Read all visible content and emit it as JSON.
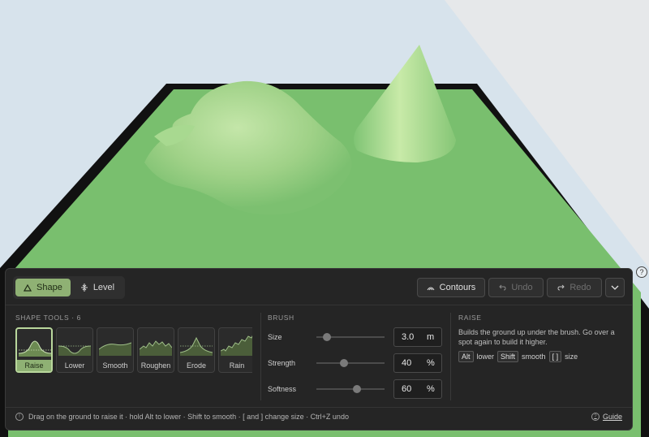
{
  "colors": {
    "sky": "#d7e3ec",
    "grass": "#79bf6e",
    "grass_light": "#a6d58c",
    "base": "#111111",
    "panel": "#252525",
    "accent": "#8fb174"
  },
  "modes": [
    {
      "label": "Shape",
      "icon": "triangle-icon",
      "active": true
    },
    {
      "label": "Level",
      "icon": "level-icon",
      "active": false
    }
  ],
  "toolbar": {
    "contours_label": "Contours",
    "undo_label": "Undo",
    "redo_label": "Redo"
  },
  "shape_tools": {
    "title": "SHAPE TOOLS · 6",
    "items": [
      {
        "label": "Raise",
        "active": true
      },
      {
        "label": "Lower",
        "active": false
      },
      {
        "label": "Smooth",
        "active": false
      },
      {
        "label": "Roughen",
        "active": false
      },
      {
        "label": "Erode",
        "active": false
      },
      {
        "label": "Rain",
        "active": false
      }
    ]
  },
  "brush": {
    "title": "BRUSH",
    "size": {
      "label": "Size",
      "value": "3.0",
      "unit": "m",
      "level": 0.16
    },
    "strength": {
      "label": "Strength",
      "value": "40",
      "unit": "%",
      "level": 0.4
    },
    "softness": {
      "label": "Softness",
      "value": "60",
      "unit": "%",
      "level": 0.6
    }
  },
  "raise_info": {
    "title": "RAISE",
    "description": "Builds the ground up under the brush. Go over a spot again to build it higher.",
    "key_alt": "Alt",
    "key_alt_desc": "lower",
    "key_shift": "Shift",
    "key_shift_desc": "smooth",
    "key_brackets": "[ ]",
    "key_brackets_desc": "size"
  },
  "status": {
    "text": "Drag on the ground to raise it · hold Alt to lower · Shift to smooth · [ and ] change size · Ctrl+Z undo",
    "guide_label": "Guide"
  }
}
